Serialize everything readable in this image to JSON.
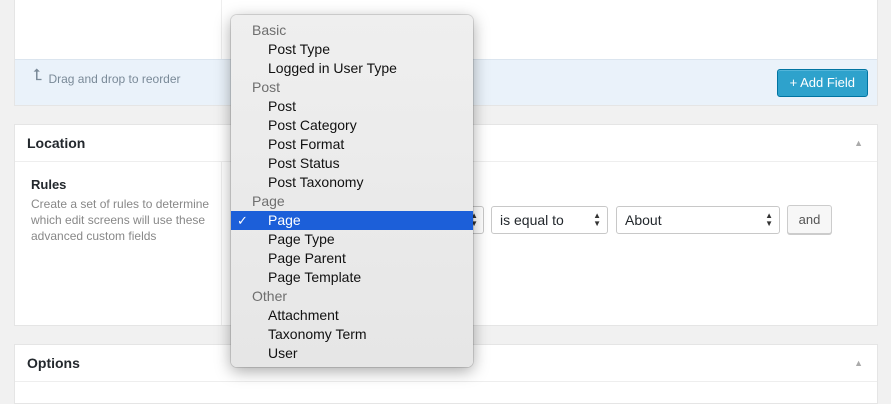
{
  "fields_footer": {
    "drag_hint": "Drag and drop to reorder",
    "add_field_label": "+ Add Field"
  },
  "location": {
    "title": "Location",
    "rules_label": "Rules",
    "rules_description": "Create a set of rules to determine which edit screens will use these advanced custom fields",
    "operator_value": "is equal to",
    "value_value": "About",
    "and_label": "and"
  },
  "options": {
    "title": "Options"
  },
  "dropdown": {
    "groups": [
      {
        "label": "Basic",
        "options": [
          "Post Type",
          "Logged in User Type"
        ]
      },
      {
        "label": "Post",
        "options": [
          "Post",
          "Post Category",
          "Post Format",
          "Post Status",
          "Post Taxonomy"
        ]
      },
      {
        "label": "Page",
        "options": [
          "Page",
          "Page Type",
          "Page Parent",
          "Page Template"
        ]
      },
      {
        "label": "Other",
        "options": [
          "Attachment",
          "Taxonomy Term",
          "User"
        ]
      }
    ],
    "selected": "Page",
    "check_glyph": "✓"
  },
  "colors": {
    "accent": "#2ea2cc",
    "selection": "#1c5fd9"
  }
}
